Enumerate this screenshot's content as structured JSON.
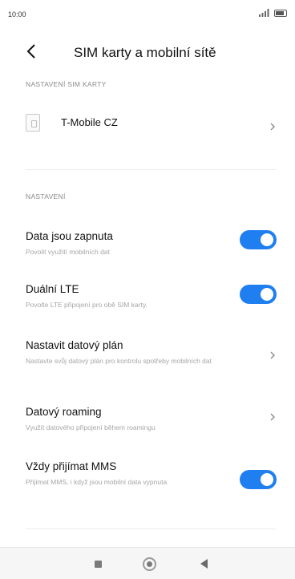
{
  "status_bar": {
    "time": "10:00",
    "icons": [
      "signal-icon",
      "battery-icon"
    ]
  },
  "header": {
    "back_icon": "back-arrow-icon",
    "title": "SIM karty a mobilní sítě"
  },
  "sim_section": {
    "label": "NASTAVENÍ SIM KARTY",
    "sim": {
      "icon": "sim-card-icon",
      "name": "T-Mobile CZ"
    }
  },
  "settings_section": {
    "label": "NASTAVENÍ",
    "items": [
      {
        "title": "Data jsou zapnuta",
        "subtitle": "Povolit využití mobilních dat",
        "control": "toggle",
        "enabled": true
      },
      {
        "title": "Duální LTE",
        "subtitle": "Povolte LTE připojení pro obě SIM karty.",
        "control": "toggle",
        "enabled": true
      },
      {
        "title": "Nastavit datový plán",
        "subtitle": "Nastavte svůj datový plán pro kontrolu spotřeby mobilních dat",
        "control": "chevron"
      },
      {
        "title": "Datový roaming",
        "subtitle": "Využít datového připojení během roamingu",
        "control": "chevron"
      },
      {
        "title": "Vždy přijímat MMS",
        "subtitle": "Přijímat MMS, i když jsou mobilní data vypnuta",
        "control": "toggle",
        "enabled": true
      }
    ]
  },
  "nav_bar": {
    "icons": [
      "recents-icon",
      "home-icon",
      "back-icon"
    ]
  },
  "colors": {
    "accent": "#1f7ff0",
    "subtitle": "#a6a6a6",
    "section_label": "#8a8a8a"
  }
}
